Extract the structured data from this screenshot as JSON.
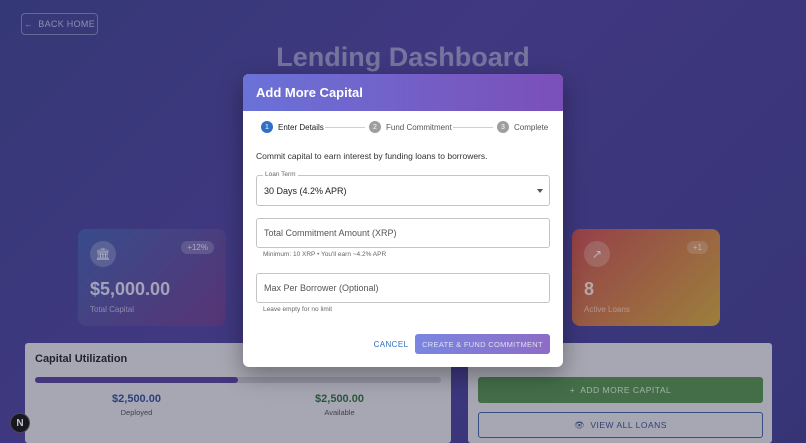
{
  "background": {
    "back_button": "BACK HOME",
    "title": "Lending Dashboard",
    "stat_left": {
      "badge": "+12%",
      "value": "$5,000.00",
      "label": "Total Capital",
      "icon": "bank-icon"
    },
    "stat_right": {
      "badge": "+1",
      "value": "8",
      "label": "Active Loans",
      "icon": "trending-up-icon"
    },
    "utilization": {
      "title": "Capital Utilization",
      "fill_fraction": 0.5,
      "deployed_value": "$2,500.00",
      "deployed_label": "Deployed",
      "available_value": "$2,500.00",
      "available_label": "Available"
    },
    "actions": {
      "add_capital": "ADD MORE CAPITAL",
      "view_loans": "VIEW ALL LOANS"
    },
    "framework_badge": "N"
  },
  "modal": {
    "title": "Add More Capital",
    "steps": [
      {
        "number": "1",
        "label": "Enter Details"
      },
      {
        "number": "2",
        "label": "Fund Commitment"
      },
      {
        "number": "3",
        "label": "Complete"
      }
    ],
    "intro": "Commit capital to earn interest by funding loans to borrowers.",
    "loan_term": {
      "label": "Loan Term",
      "value": "30 Days (4.2% APR)"
    },
    "amount": {
      "placeholder": "Total Commitment Amount (XRP)",
      "helper": "Minimum: 10 XRP • You'll earn ~4.2% APR"
    },
    "max_per_borrower": {
      "placeholder": "Max Per Borrower (Optional)",
      "helper": "Leave empty for no limit"
    },
    "cancel": "CANCEL",
    "submit": "CREATE & FUND COMMITMENT"
  },
  "colors": {
    "header_start": "#6a72d8",
    "header_end": "#7b4fb8",
    "step_active": "#2f6fc6",
    "add_capital_green": "#4e8a4a"
  }
}
